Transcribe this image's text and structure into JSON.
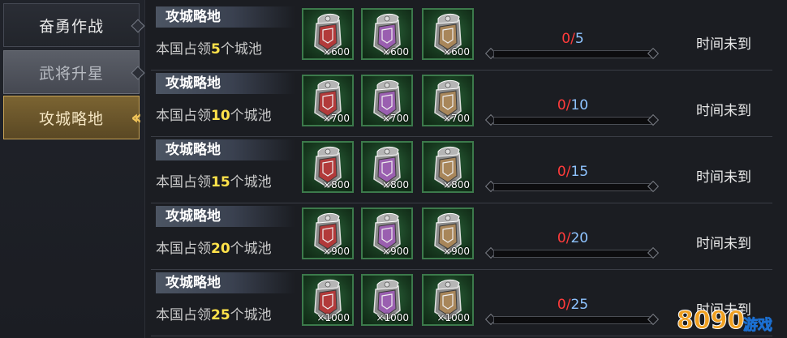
{
  "sidebar": {
    "tabs": [
      {
        "label": "奋勇作战",
        "state": "normal"
      },
      {
        "label": "武将升星",
        "state": "disabled"
      },
      {
        "label": "攻城略地",
        "state": "selected"
      }
    ]
  },
  "rows": [
    {
      "title": "攻城略地",
      "desc_prefix": "本国占领",
      "desc_number": "5",
      "desc_suffix": "个城池",
      "rewards": [
        {
          "icon": "red-chest-icon",
          "count": "×600"
        },
        {
          "icon": "purple-chest-icon",
          "count": "×600"
        },
        {
          "icon": "brown-chest-icon",
          "count": "×600"
        }
      ],
      "progress_current": "0",
      "progress_sep": "/",
      "progress_total": "5",
      "progress_fraction": 0,
      "status": "时间未到"
    },
    {
      "title": "攻城略地",
      "desc_prefix": "本国占领",
      "desc_number": "10",
      "desc_suffix": "个城池",
      "rewards": [
        {
          "icon": "red-chest-icon",
          "count": "×700"
        },
        {
          "icon": "purple-chest-icon",
          "count": "×700"
        },
        {
          "icon": "brown-chest-icon",
          "count": "×700"
        }
      ],
      "progress_current": "0",
      "progress_sep": "/",
      "progress_total": "10",
      "progress_fraction": 0,
      "status": "时间未到"
    },
    {
      "title": "攻城略地",
      "desc_prefix": "本国占领",
      "desc_number": "15",
      "desc_suffix": "个城池",
      "rewards": [
        {
          "icon": "red-chest-icon",
          "count": "×800"
        },
        {
          "icon": "purple-chest-icon",
          "count": "×800"
        },
        {
          "icon": "brown-chest-icon",
          "count": "×800"
        }
      ],
      "progress_current": "0",
      "progress_sep": "/",
      "progress_total": "15",
      "progress_fraction": 0,
      "status": "时间未到"
    },
    {
      "title": "攻城略地",
      "desc_prefix": "本国占领",
      "desc_number": "20",
      "desc_suffix": "个城池",
      "rewards": [
        {
          "icon": "red-chest-icon",
          "count": "×900"
        },
        {
          "icon": "purple-chest-icon",
          "count": "×900"
        },
        {
          "icon": "brown-chest-icon",
          "count": "×900"
        }
      ],
      "progress_current": "0",
      "progress_sep": "/",
      "progress_total": "20",
      "progress_fraction": 0,
      "status": "时间未到"
    },
    {
      "title": "攻城略地",
      "desc_prefix": "本国占领",
      "desc_number": "25",
      "desc_suffix": "个城池",
      "rewards": [
        {
          "icon": "red-chest-icon",
          "count": "×1000"
        },
        {
          "icon": "purple-chest-icon",
          "count": "×1000"
        },
        {
          "icon": "brown-chest-icon",
          "count": "×1000"
        }
      ],
      "progress_current": "0",
      "progress_sep": "/",
      "progress_total": "25",
      "progress_fraction": 0,
      "status": "时间未到"
    }
  ],
  "watermark": {
    "text": "8090游戏"
  },
  "colors": {
    "accent_gold": "#d4a43c",
    "highlight_yellow": "#ffe24a",
    "progress_red": "#ff3b3b",
    "progress_blue": "#8ec3ff",
    "reward_bg_green": "#2e6b3f"
  },
  "chest_colors": {
    "red": "#b23a3a",
    "purple": "#9a5fb0",
    "brown": "#a8865a"
  }
}
